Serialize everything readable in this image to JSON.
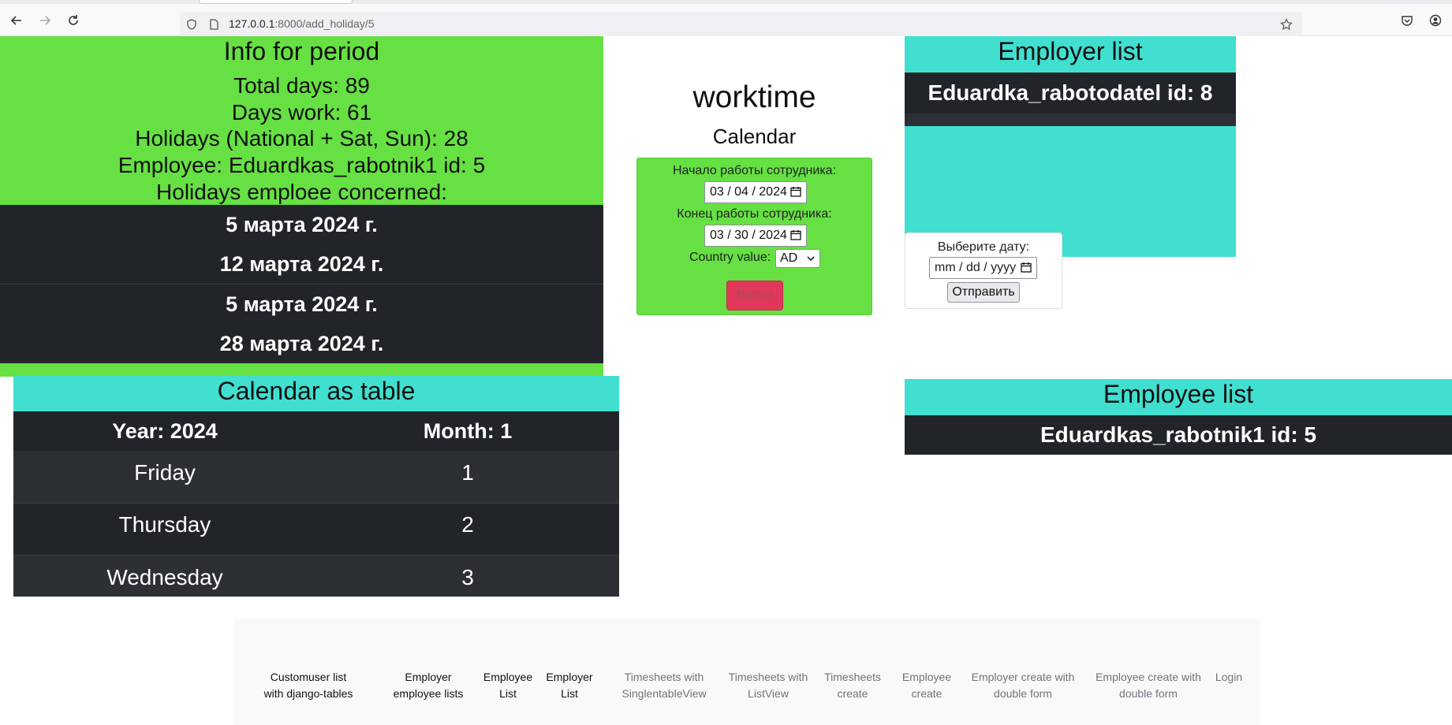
{
  "browser": {
    "url_host": "127.0.0.1",
    "url_rest": ":8000/add_holiday/5"
  },
  "info": {
    "title": "Info for period",
    "total_days": "Total days: 89",
    "days_work": "Days work: 61",
    "holidays": "Holidays (National + Sat, Sun): 28",
    "employee": "Employee: Eduardkas_rabotnik1 id: 5",
    "concerned": "Holidays emploee concerned:",
    "holiday_dates": [
      "5 марта 2024 г.",
      "12 марта 2024 г.",
      "5 марта 2024 г.",
      "28 марта 2024 г."
    ]
  },
  "calendar_table": {
    "title": "Calendar as table",
    "year_header": "Year: 2024",
    "month_header": "Month: 1",
    "rows": [
      {
        "day": "Friday",
        "num": "1"
      },
      {
        "day": "Thursday",
        "num": "2"
      },
      {
        "day": "Wednesday",
        "num": "3"
      }
    ]
  },
  "center": {
    "title": "worktime",
    "subtitle": "Calendar",
    "start_label": "Начало работы сотрудника:",
    "start_value": "03 / 04 / 2024",
    "end_label": "Конец работы сотрудника:",
    "end_value": "03 / 30 / 2024",
    "country_label": "Country value:",
    "country_value": "AD",
    "button_label": "Button"
  },
  "employer_list": {
    "title": "Employer list",
    "item": "Eduardka_rabotodatel id: 8"
  },
  "date_picker": {
    "label": "Выберите дату:",
    "placeholder": "mm / dd / yyyy",
    "submit": "Отправить"
  },
  "employee_list": {
    "title": "Employee list",
    "item": "Eduardkas_rabotnik1 id: 5"
  },
  "footer_links": [
    "Customuser list with django-tables",
    "Employer employee lists",
    "Employee List",
    "Employer List",
    "Timesheets with SinglentableView",
    "Timesheets with ListView",
    "Timesheets create",
    "Employee create",
    "Employer create with double form",
    "Employee create with double form",
    "Login"
  ],
  "colors": {
    "green": "#66e043",
    "teal": "#40dfd0",
    "dark": "#212529",
    "button": "#e0385a"
  }
}
